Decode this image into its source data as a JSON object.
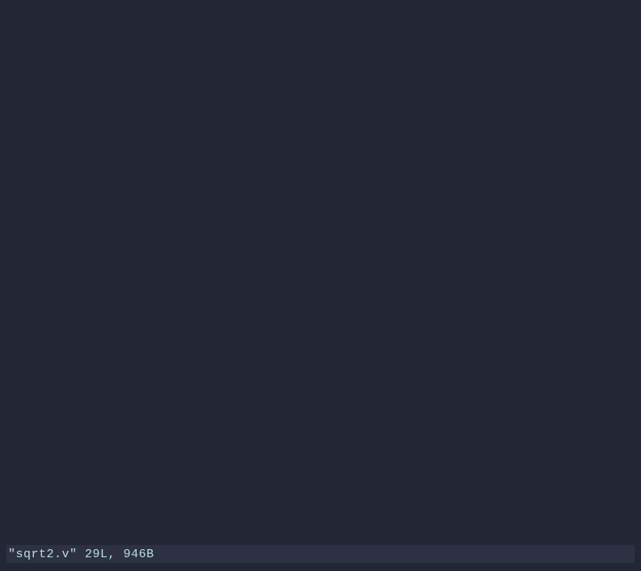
{
  "editor": {
    "content": ""
  },
  "statusBar": {
    "filename": "\"sqrt2.v\"",
    "lines": "29L",
    "bytes": "946B"
  }
}
